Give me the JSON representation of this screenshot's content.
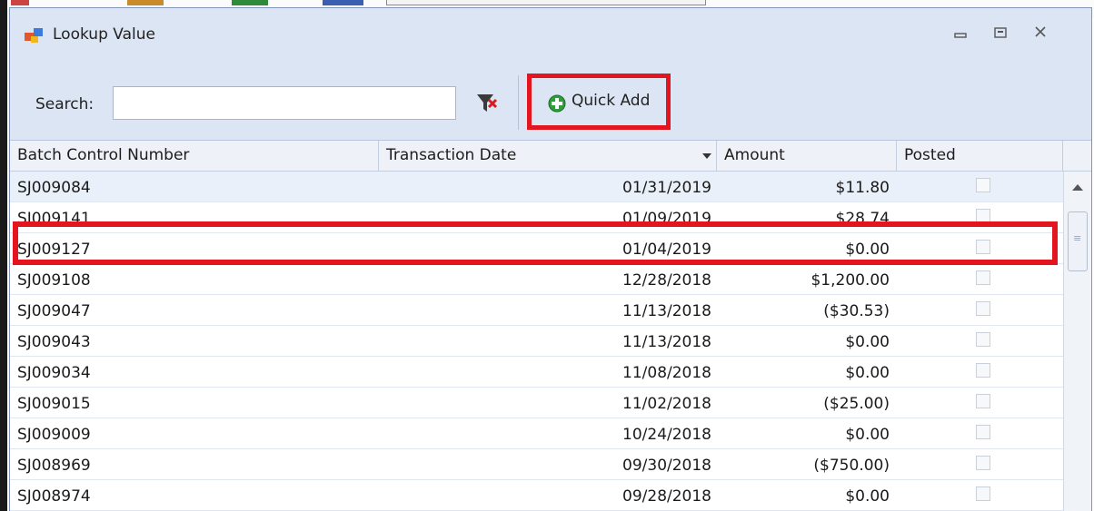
{
  "window": {
    "title": "Lookup Value"
  },
  "toolbar": {
    "search_label": "Search:",
    "search_value": "",
    "quick_add_label": "Quick Add"
  },
  "grid": {
    "columns": [
      "Batch Control Number",
      "Transaction Date",
      "Amount",
      "Posted"
    ],
    "rows": [
      {
        "batch": "SJ009084",
        "date": "01/31/2019",
        "amount": "$11.80",
        "posted": false
      },
      {
        "batch": "SJ009141",
        "date": "01/09/2019",
        "amount": "$28.74",
        "posted": false
      },
      {
        "batch": "SJ009127",
        "date": "01/04/2019",
        "amount": "$0.00",
        "posted": false
      },
      {
        "batch": "SJ009108",
        "date": "12/28/2018",
        "amount": "$1,200.00",
        "posted": false
      },
      {
        "batch": "SJ009047",
        "date": "11/13/2018",
        "amount": "($30.53)",
        "posted": false
      },
      {
        "batch": "SJ009043",
        "date": "11/13/2018",
        "amount": "$0.00",
        "posted": false
      },
      {
        "batch": "SJ009034",
        "date": "11/08/2018",
        "amount": "$0.00",
        "posted": false
      },
      {
        "batch": "SJ009015",
        "date": "11/02/2018",
        "amount": "($25.00)",
        "posted": false
      },
      {
        "batch": "SJ009009",
        "date": "10/24/2018",
        "amount": "$0.00",
        "posted": false
      },
      {
        "batch": "SJ008969",
        "date": "09/30/2018",
        "amount": "($750.00)",
        "posted": false
      },
      {
        "batch": "SJ008974",
        "date": "09/28/2018",
        "amount": "$0.00",
        "posted": false
      }
    ]
  },
  "colors": {
    "highlight": "#e3151f",
    "chrome": "#dbe5f3",
    "header": "#eef2f8"
  },
  "icons": {
    "window": "lookup-window-icon",
    "filter": "clear-filter-icon",
    "quick_add": "green-plus-icon",
    "minimize": "minimize-icon",
    "maximize": "maximize-icon",
    "close": "close-icon"
  }
}
